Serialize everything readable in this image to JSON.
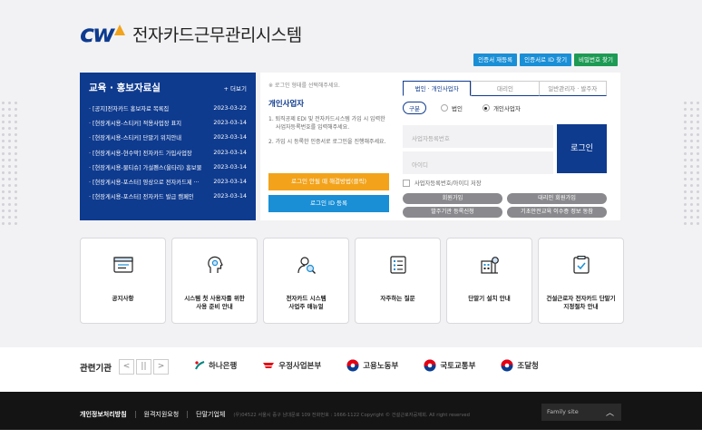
{
  "logo": {
    "mark": "cw",
    "title": "전자카드근무관리시스템"
  },
  "top_buttons": [
    {
      "label": "인증서 재등록",
      "color": "#1a8fd6"
    },
    {
      "label": "인증서로 ID 찾기",
      "color": "#1a8fd6"
    },
    {
      "label": "비밀번호 찾기",
      "color": "#1d9a54"
    }
  ],
  "notice": {
    "title": "교육 · 홍보자료실",
    "more": "+ 더보기",
    "items": [
      {
        "title": "· [공지]전자카드 홍보자료 목록집",
        "date": "2023-03-22"
      },
      {
        "title": "· [현장게시용-스티커] 적용사업장 표지",
        "date": "2023-03-14"
      },
      {
        "title": "· [현장게시용-스티커] 단말기 위치안내",
        "date": "2023-03-14"
      },
      {
        "title": "· [현장게시용-현수막] 전자카드 가입사업장",
        "date": "2023-03-14"
      },
      {
        "title": "· [현장게시용-물티슈] 가설펜스(울타리) 홍보물",
        "date": "2023-03-14"
      },
      {
        "title": "· [현장게시용-포스터] 영상으로 전자카드제 ···",
        "date": "2023-03-14"
      },
      {
        "title": "· [현장게시용-포스터] 전자카드 발급 캠페인",
        "date": "2023-03-14"
      }
    ]
  },
  "login": {
    "hint": "※ 로그인 형태를 선택해주세요.",
    "sub_title": "개인사업자",
    "steps": [
      "1. 퇴직공제 EDI 및 전자카드시스템 가입 시 입력한 사업자등록번호를 입력해주세요.",
      "2. 가입 시 등록한 인증서로 로그인을 진행해주세요."
    ],
    "error_button": "로그인 안될 때 해결방법(클릭)",
    "id_register_button": "로그인 ID 등록",
    "tabs": [
      "법인 · 개인사업자",
      "대리인",
      "일반관리자 · 발주자"
    ],
    "type_label": "구분",
    "type_options": [
      "법인",
      "개인사업자"
    ],
    "type_selected": "개인사업자",
    "bizno_placeholder": "사업자등록번호",
    "id_placeholder": "아이디",
    "login_button": "로그인",
    "save_label": "사업자등록번호/아이디 저장",
    "pill_buttons": [
      "회원가입",
      "대리인 회원가입",
      "발주기관 등록신청",
      "기초안전교육 이수증 정보 동참"
    ]
  },
  "cards": [
    {
      "label": "공지사항",
      "icon": "notice-board-icon"
    },
    {
      "label": "시스템 첫 사용자를 위한\n사용 준비 안내",
      "icon": "gear-head-icon"
    },
    {
      "label": "전자카드 시스템\n사업주 매뉴얼",
      "icon": "user-search-icon"
    },
    {
      "label": "자주하는 질문",
      "icon": "faq-list-icon"
    },
    {
      "label": "단말기 설치 안내",
      "icon": "building-gear-icon"
    },
    {
      "label": "건설근로자 전자카드 단말기\n지정절차 안내",
      "icon": "checklist-icon"
    }
  ],
  "related": {
    "title": "관련기관",
    "controls": [
      "<",
      "||",
      ">"
    ],
    "logos": [
      "하나은행",
      "우정사업본부",
      "고용노동부",
      "국토교통부",
      "조달청"
    ]
  },
  "footer": {
    "links": [
      "개인정보처리방침",
      "원격지원요청",
      "단말기업체"
    ],
    "address": "(우)04522 서울시 중구 남대문로 109 전화번호 : 1666-1122   Copyright © 건설근로자공제회. All right reserved",
    "family_site": "Family site"
  },
  "colors": {
    "navy": "#0f3b8f",
    "orange": "#f2a31b",
    "blue_btn": "#1a8fd6",
    "green_btn": "#1d9a54"
  }
}
